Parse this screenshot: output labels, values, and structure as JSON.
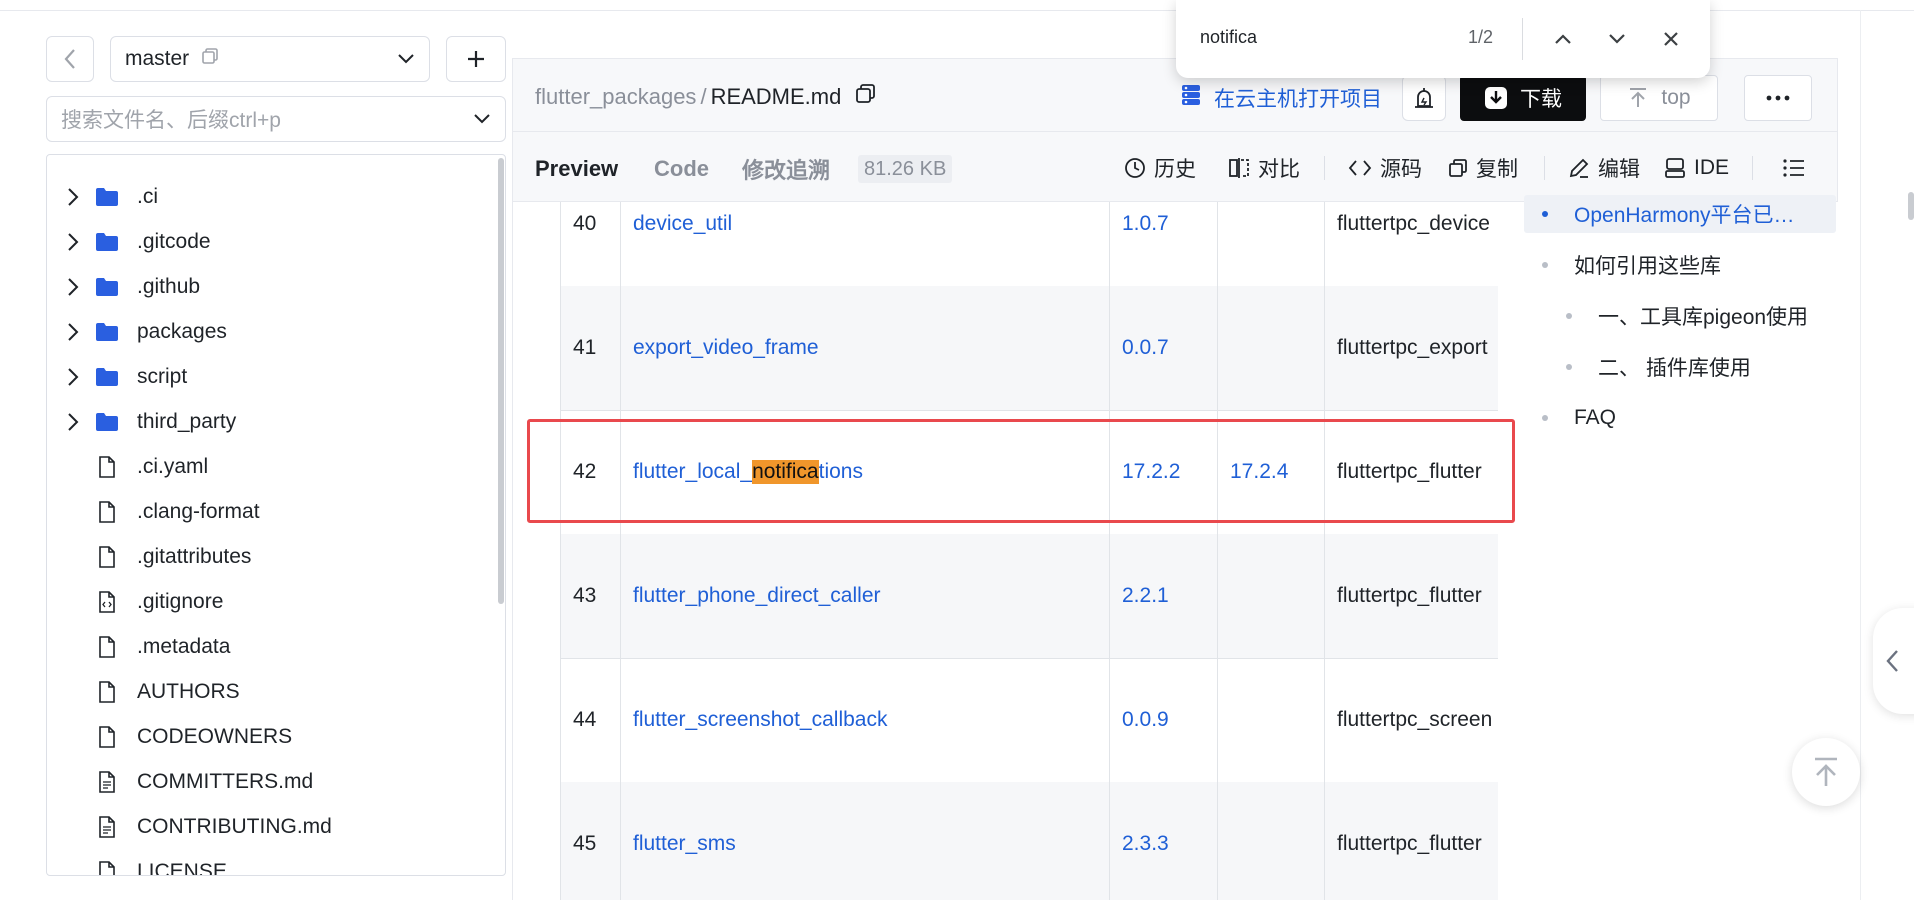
{
  "sidebar": {
    "branch": "master",
    "search_placeholder": "搜索文件名、后缀ctrl+p",
    "items": [
      {
        "label": ".ci",
        "type": "folder"
      },
      {
        "label": ".gitcode",
        "type": "folder"
      },
      {
        "label": ".github",
        "type": "folder"
      },
      {
        "label": "packages",
        "type": "folder"
      },
      {
        "label": "script",
        "type": "folder"
      },
      {
        "label": "third_party",
        "type": "folder"
      },
      {
        "label": ".ci.yaml",
        "type": "file"
      },
      {
        "label": ".clang-format",
        "type": "file"
      },
      {
        "label": ".gitattributes",
        "type": "file"
      },
      {
        "label": ".gitignore",
        "type": "code-file"
      },
      {
        "label": ".metadata",
        "type": "file"
      },
      {
        "label": "AUTHORS",
        "type": "file"
      },
      {
        "label": "CODEOWNERS",
        "type": "file"
      },
      {
        "label": "COMMITTERS.md",
        "type": "doc-file"
      },
      {
        "label": "CONTRIBUTING.md",
        "type": "doc-file"
      },
      {
        "label": "LICENSE",
        "type": "file"
      }
    ]
  },
  "header": {
    "repo": "flutter_packages",
    "separator": "/",
    "file": "README.md",
    "cloud_link": "在云主机打开项目",
    "download_label": "下载",
    "top_label": "top",
    "more_label": "···"
  },
  "toolbar": {
    "tabs": [
      "Preview",
      "Code",
      "修改追溯"
    ],
    "size": "81.26 KB",
    "tools": [
      "历史",
      "对比",
      "源码",
      "复制",
      "编辑",
      "IDE"
    ]
  },
  "table": {
    "rows": [
      {
        "num": "40",
        "name": "device_util",
        "v1": "1.0.7",
        "v2": "",
        "pkg": "fluttertpc_device"
      },
      {
        "num": "41",
        "name": "export_video_frame",
        "v1": "0.0.7",
        "v2": "",
        "pkg": "fluttertpc_export"
      },
      {
        "num": "42",
        "name_pre": "flutter_local_",
        "name_hl": "notifica",
        "name_post": "tions",
        "v1": "17.2.2",
        "v2": "17.2.4",
        "pkg": "fluttertpc_flutter"
      },
      {
        "num": "43",
        "name": "flutter_phone_direct_caller",
        "v1": "2.2.1",
        "v2": "",
        "pkg": "fluttertpc_flutter"
      },
      {
        "num": "44",
        "name": "flutter_screenshot_callback",
        "v1": "0.0.9",
        "v2": "",
        "pkg": "fluttertpc_screen"
      },
      {
        "num": "45",
        "name": "flutter_sms",
        "v1": "2.3.3",
        "v2": "",
        "pkg": "fluttertpc_flutter"
      }
    ]
  },
  "toc": {
    "items": [
      {
        "label": "OpenHarmony平台已…",
        "active": true
      },
      {
        "label": "如何引用这些库",
        "active": false
      },
      {
        "label": "一、工具库pigeon使用",
        "active": false
      },
      {
        "label": "二、 插件库使用",
        "active": false
      },
      {
        "label": "FAQ",
        "active": false
      }
    ]
  },
  "findbar": {
    "query": "notifica",
    "count": "1/2"
  },
  "colors": {
    "accent": "#1f5fd6",
    "highlight": "#f0962b",
    "annotation_box": "#e9494d",
    "folder": "#2a5fe0"
  }
}
